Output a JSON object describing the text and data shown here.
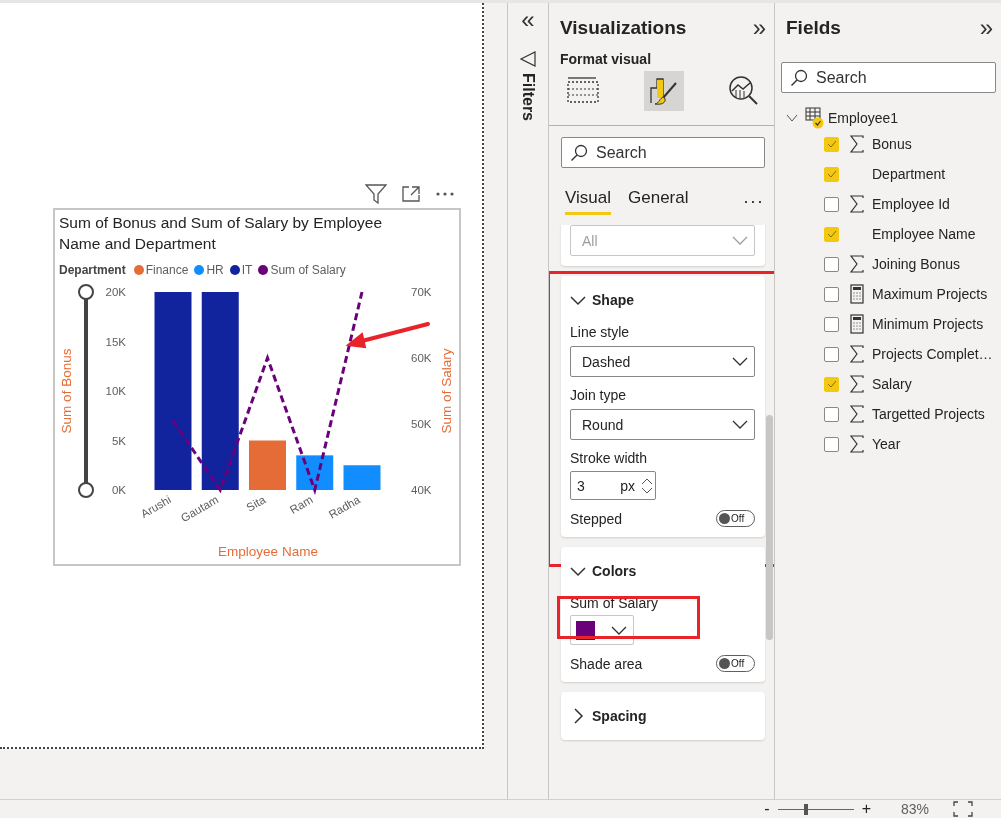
{
  "report": {
    "visual": {
      "arrow": true,
      "chart_data": {
        "type": "bar",
        "title": "Sum of Bonus and Sum of Salary by Employee Name and Department",
        "legend_title": "Department",
        "xlabel": "Employee Name",
        "ylabel": "Sum of Bonus",
        "categories": [
          "Arushi",
          "Gautam",
          "Sita",
          "Ram",
          "Radha"
        ],
        "series": [
          {
            "name": "Finance",
            "color": "#e66c37",
            "values": [
              null,
              null,
              5000,
              null,
              null
            ]
          },
          {
            "name": "HR",
            "color": "#118dff",
            "values": [
              null,
              null,
              null,
              3500,
              2500
            ]
          },
          {
            "name": "IT",
            "color": "#12239e",
            "values": [
              20000,
              20000,
              null,
              null,
              null
            ]
          }
        ],
        "ylim": [
          0,
          20000
        ],
        "yticks": [
          {
            "value": 0,
            "label": "0K"
          },
          {
            "value": 5000,
            "label": "5K"
          },
          {
            "value": 10000,
            "label": "10K"
          },
          {
            "value": 15000,
            "label": "15K"
          },
          {
            "value": 20000,
            "label": "20K"
          }
        ]
      },
      "line_overlay": {
        "chart_data": {
          "type": "line",
          "ylabel": "Sum of Salary",
          "series": [
            {
              "name": "Sum of Salary",
              "color": "#6b007b",
              "line_style": "dashed",
              "values": [
                50500,
                40000,
                60000,
                40000,
                70000
              ]
            }
          ],
          "ylim": [
            40000,
            70000
          ],
          "yticks": [
            {
              "value": 40000,
              "label": "40K"
            },
            {
              "value": 50000,
              "label": "50K"
            },
            {
              "value": 60000,
              "label": "60K"
            },
            {
              "value": 70000,
              "label": "70K"
            }
          ]
        }
      }
    }
  },
  "filters": {
    "collapse": "«",
    "title": "Filters"
  },
  "visualizations": {
    "title": "Visualizations",
    "expand": "»",
    "subtitle": "Format visual",
    "build_tabs": [
      {
        "kind": "fields",
        "selected": false
      },
      {
        "kind": "format",
        "selected": true
      },
      {
        "kind": "analytics",
        "selected": false
      }
    ],
    "search": {
      "placeholder": "Search"
    },
    "tabs": [
      {
        "label": "Visual",
        "selected": true
      },
      {
        "label": "General",
        "selected": false
      }
    ],
    "more": "···",
    "cards": [
      {
        "kind": "partial",
        "highlighted": false,
        "rows": [
          {
            "kind": "dropdown",
            "value": "All",
            "disabled": true
          }
        ]
      },
      {
        "kind": "section",
        "title": "Shape",
        "expanded": true,
        "highlighted": true,
        "rows": [
          {
            "kind": "dropdown",
            "label": "Line style",
            "value": "Dashed",
            "disabled": false
          },
          {
            "kind": "dropdown",
            "label": "Join type",
            "value": "Round",
            "disabled": false
          },
          {
            "kind": "number",
            "label": "Stroke width",
            "value": "3",
            "unit": "px"
          },
          {
            "kind": "toggle",
            "label": "Stepped",
            "on": false,
            "text": "Off"
          }
        ]
      },
      {
        "kind": "section",
        "title": "Colors",
        "expanded": true,
        "highlighted": false,
        "rows": [
          {
            "kind": "color",
            "label": "Sum of Salary",
            "color": "#6b007b",
            "highlighted": true
          },
          {
            "kind": "toggle",
            "label": "Shade area",
            "on": false,
            "text": "Off"
          }
        ]
      },
      {
        "kind": "section",
        "title": "Spacing",
        "expanded": false,
        "highlighted": false
      }
    ]
  },
  "fields": {
    "title": "Fields",
    "expand": "»",
    "search": {
      "placeholder": "Search"
    },
    "table": {
      "name": "Employee1",
      "expanded": true,
      "children": [
        {
          "label": "Bonus",
          "kind": "sum",
          "checked": true
        },
        {
          "label": "Department",
          "kind": "text",
          "checked": true
        },
        {
          "label": "Employee Id",
          "kind": "sum",
          "checked": false
        },
        {
          "label": "Employee Name",
          "kind": "text",
          "checked": true
        },
        {
          "label": "Joining Bonus",
          "kind": "sum",
          "checked": false
        },
        {
          "label": "Maximum Projects",
          "kind": "calc",
          "checked": false
        },
        {
          "label": "Minimum Projects",
          "kind": "calc",
          "checked": false
        },
        {
          "label": "Projects Complet…",
          "kind": "sum",
          "checked": false
        },
        {
          "label": "Salary",
          "kind": "sum",
          "checked": true
        },
        {
          "label": "Targetted Projects",
          "kind": "sum",
          "checked": false
        },
        {
          "label": "Year",
          "kind": "sum",
          "checked": false
        }
      ]
    }
  },
  "status_bar": {
    "minus": "-",
    "level": 0.35,
    "plus": "+",
    "zoom": "83%"
  }
}
